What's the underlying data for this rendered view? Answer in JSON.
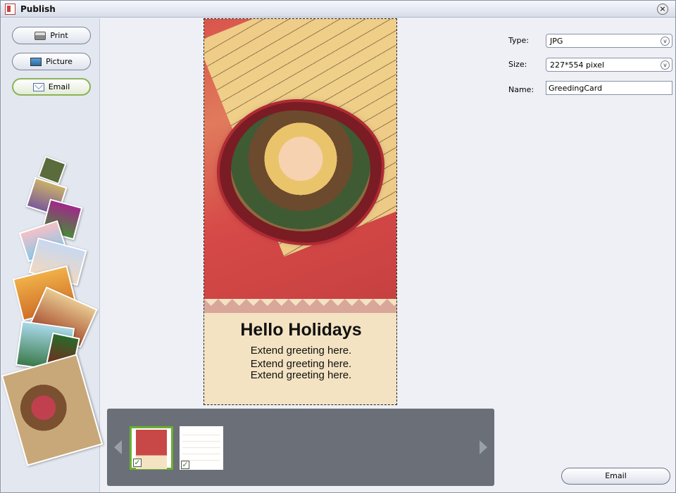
{
  "window": {
    "title": "Publish"
  },
  "sidebar": {
    "buttons": [
      {
        "label": "Print",
        "icon": "printer-icon"
      },
      {
        "label": "Picture",
        "icon": "picture-icon"
      },
      {
        "label": "Email",
        "icon": "envelope-icon",
        "active": true
      }
    ]
  },
  "preview": {
    "heading": "Hello Holidays",
    "lines": [
      "Extend greeting here.",
      "Extend greeting here.",
      "Extend greeting here."
    ]
  },
  "thumbnails": [
    {
      "selected": true,
      "checked": true
    },
    {
      "selected": false,
      "checked": true
    }
  ],
  "options": {
    "type_label": "Type:",
    "type_value": "JPG",
    "size_label": "Size:",
    "size_value": "227*554 pixel",
    "name_label": "Name:",
    "name_value": "GreedingCard"
  },
  "footer": {
    "email_label": "Email"
  },
  "colors": {
    "accent_green": "#6ab02e",
    "thumb_bar": "#6b6f78"
  }
}
